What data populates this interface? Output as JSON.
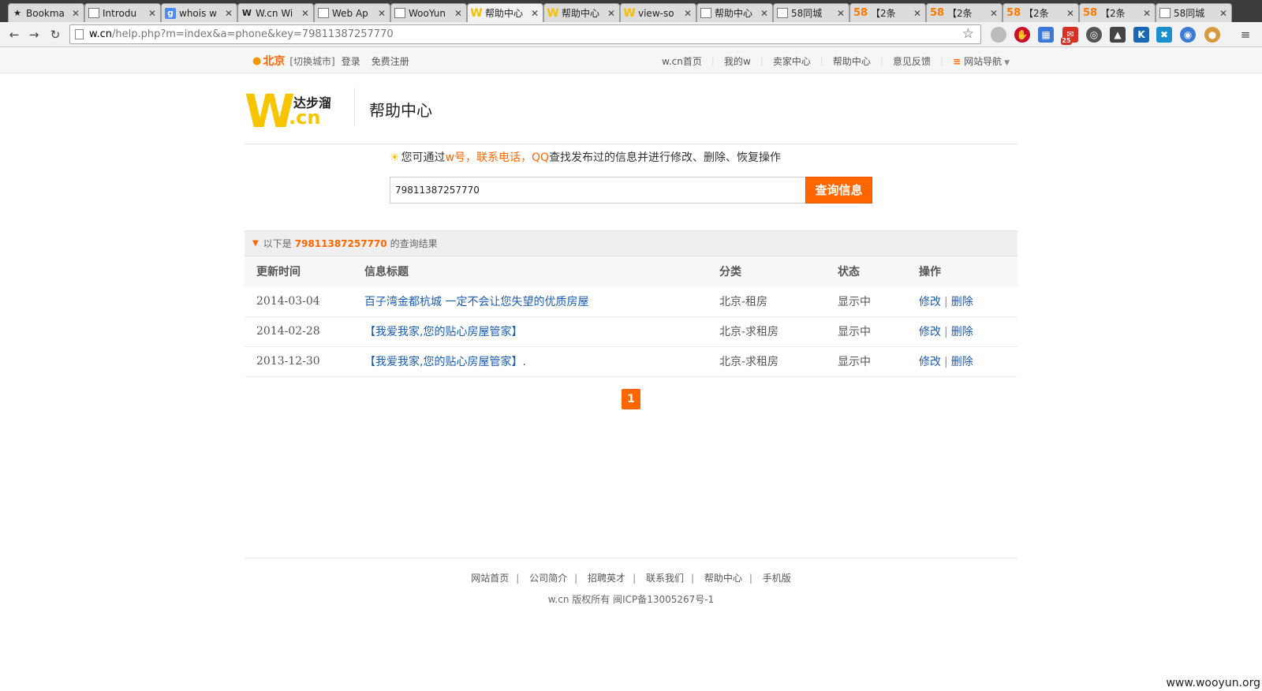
{
  "browser": {
    "tabs": [
      {
        "icon": "star-icon",
        "label": "Bookma"
      },
      {
        "icon": "doc-icon",
        "label": "Introdu"
      },
      {
        "icon": "google-icon",
        "label": "whois w"
      },
      {
        "icon": "wooyun-w-icon",
        "label": "W.cn Wi"
      },
      {
        "icon": "doc-icon",
        "label": "Web Ap"
      },
      {
        "icon": "doc-icon",
        "label": "WooYun"
      },
      {
        "icon": "wcn-icon",
        "label": "帮助中心"
      },
      {
        "icon": "wcn-icon",
        "label": "帮助中心"
      },
      {
        "icon": "wcn-icon",
        "label": "view-so"
      },
      {
        "icon": "doc-icon",
        "label": "帮助中心"
      },
      {
        "icon": "doc-icon",
        "label": "58同城"
      },
      {
        "icon": "58-icon",
        "label": "【2条"
      },
      {
        "icon": "58-icon",
        "label": "【2条"
      },
      {
        "icon": "58-icon",
        "label": "【2条"
      },
      {
        "icon": "58-icon",
        "label": "【2条"
      },
      {
        "icon": "doc-icon",
        "label": "58同城"
      }
    ],
    "active_tab": 6,
    "url_host": "w.cn",
    "url_path": "/help.php?m=index&a=phone&key=79811387257770",
    "extension_badge": "25"
  },
  "topbar": {
    "city": "北京",
    "switch_city": "[切换城市]",
    "login": "登录",
    "register": "免费注册",
    "nav": [
      "w.cn首页",
      "我的w",
      "卖家中心",
      "帮助中心",
      "意见反馈"
    ],
    "site_nav": "网站导航"
  },
  "header": {
    "logo_text": "达步溜",
    "logo_suffix": ".cn",
    "logo_w": "W",
    "title": "帮助中心"
  },
  "search": {
    "tip_prefix": "您可通过",
    "tip_highlight": "w号，联系电话，QQ",
    "tip_suffix": "查找发布过的信息并进行修改、删除、恢复操作",
    "value": "79811387257770",
    "button": "查询信息"
  },
  "results": {
    "prefix": "以下是",
    "keyword": "79811387257770",
    "suffix": "的查询结果",
    "columns": [
      "更新时间",
      "信息标题",
      "分类",
      "状态",
      "操作"
    ],
    "rows": [
      {
        "date": "2014-03-04",
        "title": "百子湾金都杭城 一定不会让您失望的优质房屋",
        "category": "北京-租房",
        "status": "显示中",
        "edit": "修改",
        "delete": "删除"
      },
      {
        "date": "2014-02-28",
        "title": "【我爱我家,您的贴心房屋管家】",
        "category": "北京-求租房",
        "status": "显示中",
        "edit": "修改",
        "delete": "删除"
      },
      {
        "date": "2013-12-30",
        "title": "【我爱我家,您的贴心房屋管家】.",
        "category": "北京-求租房",
        "status": "显示中",
        "edit": "修改",
        "delete": "删除"
      }
    ],
    "page": "1"
  },
  "footer": {
    "links": [
      "网站首页",
      "公司简介",
      "招聘英才",
      "联系我们",
      "帮助中心",
      "手机版"
    ],
    "copyright": "w.cn 版权所有 闽ICP备13005267号-1"
  },
  "watermark": "www.wooyun.org",
  "colors": {
    "accent": "#ff6600",
    "link": "#1a5cb0",
    "logo": "#f6c500"
  }
}
